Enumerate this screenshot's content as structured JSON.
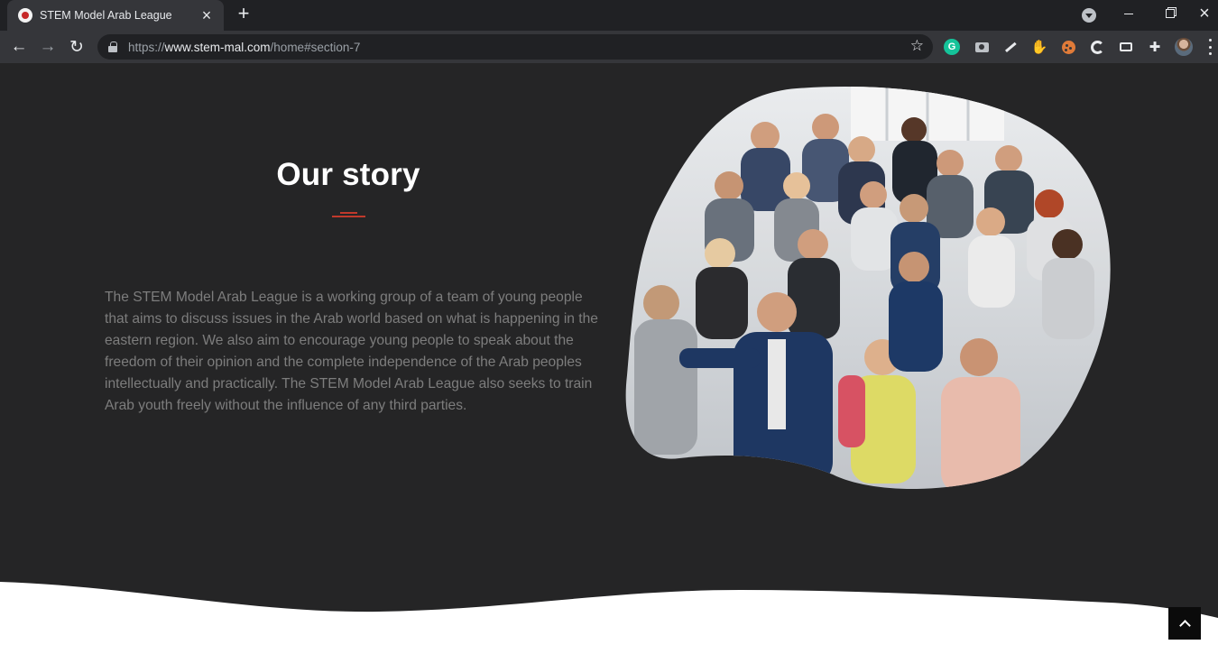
{
  "browser": {
    "tab": {
      "title": "STEM Model Arab League"
    },
    "address": {
      "scheme": "https://",
      "host": "www.stem-mal.com",
      "path": "/home#section-7"
    },
    "extensions": {
      "grammarly_letter": "G",
      "pen_badge": "-"
    }
  },
  "section": {
    "title": "Our story",
    "body": "The STEM Model Arab League is a working group of a team of young people that aims to discuss issues in the Arab world based on what is happening in the eastern region. We also aim to encourage young people to speak about the freedom of their opinion and the complete independence of the Arab peoples intellectually and practically. The STEM Model Arab League also seeks to train Arab youth freely without the influence of any third parties."
  },
  "colors": {
    "page_background": "#252526",
    "accent": "#c0392b",
    "heading": "#ffffff",
    "body_text": "#7d7d7d",
    "wave": "#ffffff",
    "back_to_top": "#0b0b0b"
  },
  "icons": {
    "back": "arrow-left-icon",
    "forward": "arrow-right-icon",
    "reload": "reload-icon",
    "secure": "lock-icon",
    "bookmark": "star-icon",
    "scroll_top": "chevron-up-icon"
  }
}
